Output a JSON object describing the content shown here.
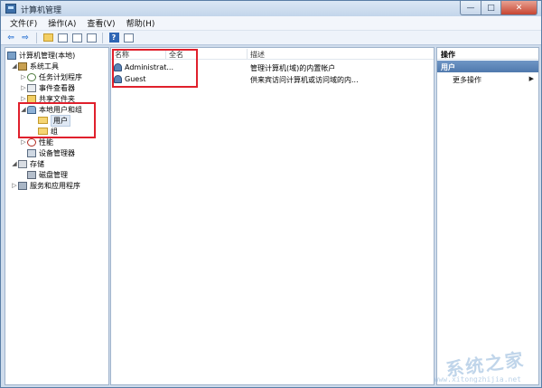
{
  "window": {
    "title": "计算机管理"
  },
  "caption": {
    "minimize": "—",
    "maximize": "□",
    "close": "✕"
  },
  "menu": [
    "文件(F)",
    "操作(A)",
    "查看(V)",
    "帮助(H)"
  ],
  "tree": {
    "root": "计算机管理(本地)",
    "system_tools": "系统工具",
    "task_scheduler": "任务计划程序",
    "event_viewer": "事件查看器",
    "shared_folders": "共享文件夹",
    "local_users_groups": "本地用户和组",
    "users": "用户",
    "groups": "组",
    "performance": "性能",
    "device_manager": "设备管理器",
    "storage": "存储",
    "disk_management": "磁盘管理",
    "services_apps": "服务和应用程序"
  },
  "list": {
    "columns": [
      "名称",
      "全名",
      "描述"
    ],
    "rows": [
      {
        "name": "Administrat...",
        "full_name": "",
        "description": "管理计算机(域)的内置帐户"
      },
      {
        "name": "Guest",
        "full_name": "",
        "description": "供来宾访问计算机或访问域的内..."
      }
    ]
  },
  "actions": {
    "header": "操作",
    "section": "用户",
    "more": "更多操作",
    "more_arrow": "▶"
  },
  "watermark": {
    "text": "系统之家",
    "url": "www.xitongzhijia.net"
  }
}
